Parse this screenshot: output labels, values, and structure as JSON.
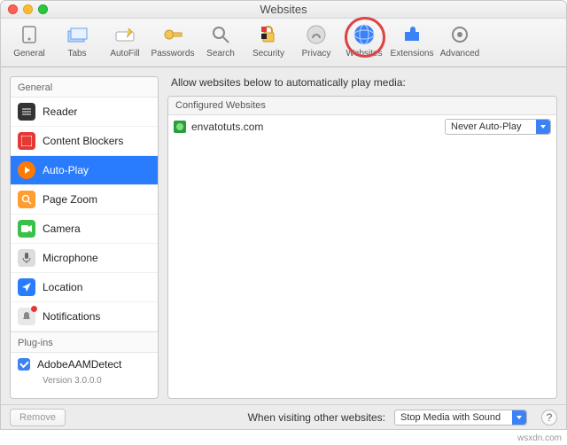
{
  "window": {
    "title": "Websites"
  },
  "toolbar": {
    "items": [
      {
        "label": "General"
      },
      {
        "label": "Tabs"
      },
      {
        "label": "AutoFill"
      },
      {
        "label": "Passwords"
      },
      {
        "label": "Search"
      },
      {
        "label": "Security"
      },
      {
        "label": "Privacy"
      },
      {
        "label": "Websites"
      },
      {
        "label": "Extensions"
      },
      {
        "label": "Advanced"
      }
    ]
  },
  "sidebar": {
    "group1": "General",
    "items": [
      {
        "label": "Reader"
      },
      {
        "label": "Content Blockers"
      },
      {
        "label": "Auto-Play"
      },
      {
        "label": "Page Zoom"
      },
      {
        "label": "Camera"
      },
      {
        "label": "Microphone"
      },
      {
        "label": "Location"
      },
      {
        "label": "Notifications"
      }
    ],
    "group2": "Plug-ins",
    "plugin": {
      "label": "AdobeAAMDetect",
      "version": "Version 3.0.0.0"
    }
  },
  "main": {
    "header": "Allow websites below to automatically play media:",
    "col_header": "Configured Websites",
    "rows": [
      {
        "site": "envatotuts.com",
        "setting": "Never Auto-Play"
      }
    ]
  },
  "bottom": {
    "remove": "Remove",
    "label": "When visiting other websites:",
    "setting": "Stop Media with Sound"
  },
  "watermark": "wsxdn.com"
}
